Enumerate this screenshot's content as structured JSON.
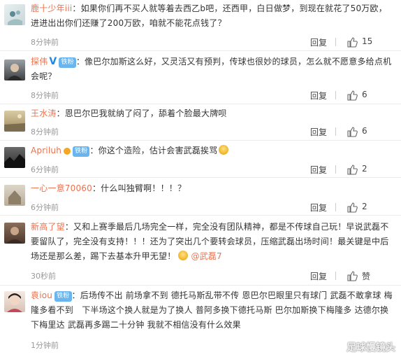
{
  "comments": [
    {
      "user": "鹿十少年iii",
      "text": "：如果你们再不买人就等着去西乙b吧，还西甲，白日做梦，到现在就花了50万欧，进进出出你们还赚了200万欧，咱就不能花点钱了？",
      "time": "8分钟前",
      "reply_label": "回复",
      "likes": "15"
    },
    {
      "user": "探伟",
      "badge": "铁粉",
      "text": "：像巴尔加斯这么好，又灵活又有预判，传球也很妙的球员，怎么就不愿意多给点机会呢？",
      "time": "8分钟前",
      "reply_label": "回复",
      "likes": "6"
    },
    {
      "user": "王水涛",
      "text": "：恩巴尔巴我就纳了闷了，舔着个脸最大牌呗",
      "time": "8分钟前",
      "reply_label": "回复",
      "likes": "6"
    },
    {
      "user": "Apriluh",
      "badge": "铁粉",
      "text": "：你这个造险，估计会害武磊挨骂",
      "time": "6分钟前",
      "reply_label": "回复",
      "likes": "2"
    },
    {
      "user": "一心一意70060",
      "text": "：什么叫独臂啊！！！？",
      "time": "6分钟前",
      "reply_label": "回复",
      "likes": "2"
    },
    {
      "user": "新高了望",
      "text": "：又和上赛季最后几场完全一样，完全没有团队精神，都是不传球自己玩！早说武磊不要留队了，完全没有支持！！！还为了突出几个要转会球员，压缩武磊出场时间！最关键是中后场还是那么差，踢下去基本升甲无望！",
      "mention": "@武磊7",
      "time": "30秒前",
      "reply_label": "回复",
      "likes": "赞"
    },
    {
      "user": "袁iou",
      "badge": "铁粉",
      "text": "：后场传不出 前场拿不到 德托马斯乱带不传 恩巴尔巴眼里只有球门 武磊不敢拿球 梅隆多看不到　下半场这个换人就是为了换人 普阿多换下德托马斯 巴尔加斯换下梅隆多 达德尔换下梅里达 武磊再多踢二十分钟 我就不相信没有什么效果",
      "time": "1分钟前",
      "reply_label": "回复",
      "likes": ""
    }
  ],
  "watermark": "足球慢镜头",
  "colors": {
    "username": "#eb7350",
    "badge": "#6ab5ee",
    "time": "#999999"
  }
}
